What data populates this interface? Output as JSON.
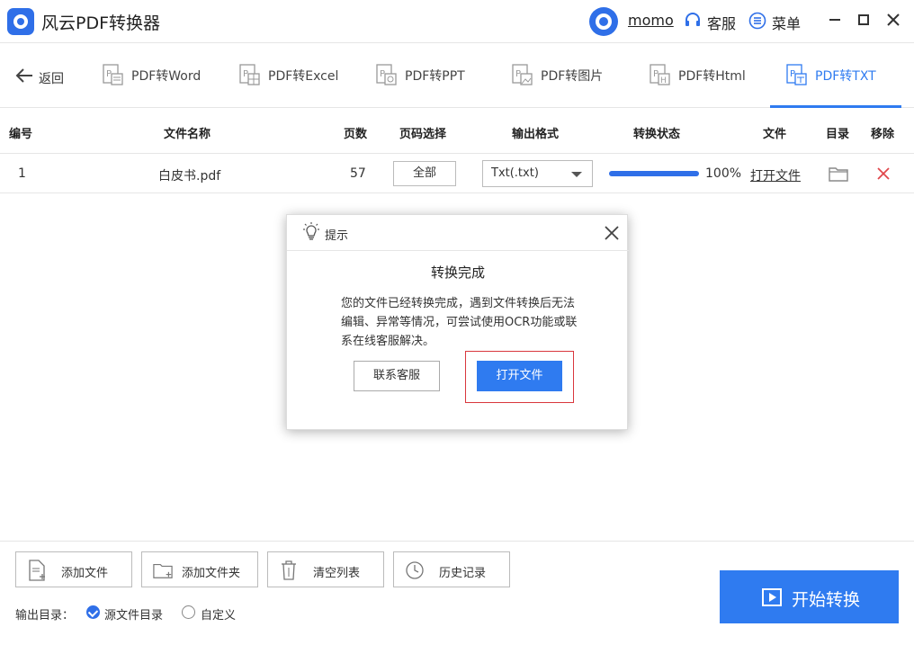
{
  "app": {
    "title": "风云PDF转换器",
    "user": "momo",
    "service": "客服",
    "menu": "菜单"
  },
  "nav": {
    "back": "返回",
    "tabs": [
      {
        "label": "PDF转Word",
        "icon": "pdf-word-icon"
      },
      {
        "label": "PDF转Excel",
        "icon": "pdf-excel-icon"
      },
      {
        "label": "PDF转PPT",
        "icon": "pdf-ppt-icon"
      },
      {
        "label": "PDF转图片",
        "icon": "pdf-image-icon"
      },
      {
        "label": "PDF转Html",
        "icon": "pdf-html-icon"
      },
      {
        "label": "PDF转TXT",
        "icon": "pdf-txt-icon",
        "active": true
      }
    ]
  },
  "table": {
    "headers": {
      "index": "编号",
      "name": "文件名称",
      "pages": "页数",
      "range": "页码选择",
      "format": "输出格式",
      "status": "转换状态",
      "file": "文件",
      "dir": "目录",
      "remove": "移除"
    },
    "rows": [
      {
        "index": "1",
        "name": "白皮书.pdf",
        "pages": "57",
        "range": "全部",
        "format": "Txt(.txt)",
        "progress": 1.0,
        "progress_text": "100%",
        "open": "打开文件"
      }
    ]
  },
  "dialog": {
    "title": "提示",
    "heading": "转换完成",
    "message": "您的文件已经转换完成，遇到文件转换后无法编辑、异常等情况，可尝试使用OCR功能或联系在线客服解决。",
    "contact": "联系客服",
    "open": "打开文件"
  },
  "toolbar": {
    "add_file": "添加文件",
    "add_folder": "添加文件夹",
    "clear": "清空列表",
    "history": "历史记录"
  },
  "output": {
    "label": "输出目录：",
    "source": "源文件目录",
    "custom": "自定义",
    "selected": "source"
  },
  "start": "开始转换",
  "colors": {
    "accent": "#2f7bf0",
    "remove": "#e0474c",
    "frame": "#d9373d"
  }
}
